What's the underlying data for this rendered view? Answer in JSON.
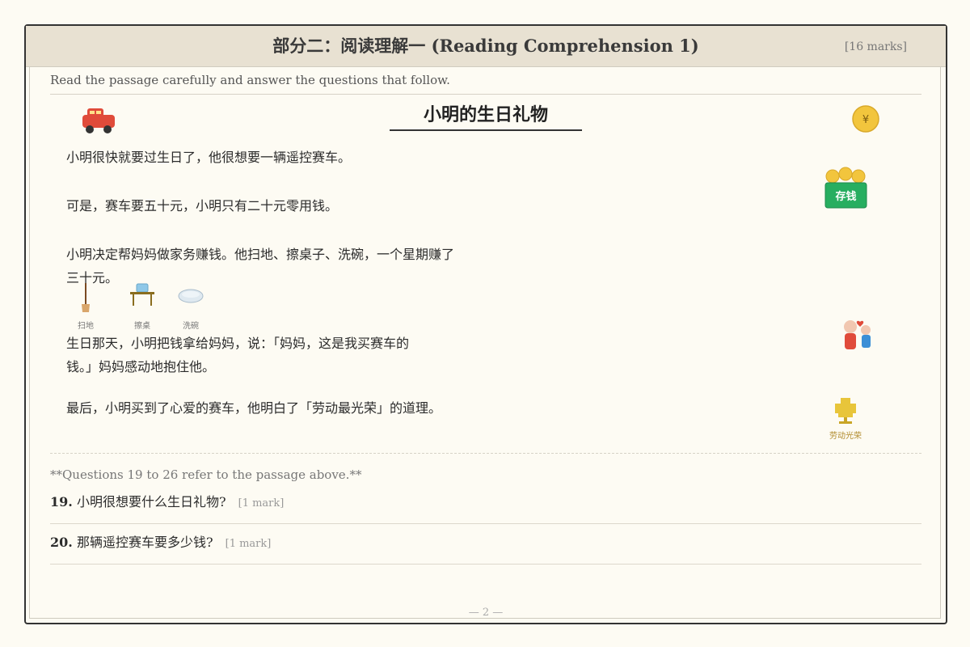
{
  "header": {
    "title": "部分二：阅读理解一 (Reading Comprehension 1)",
    "marks": "[16 marks]"
  },
  "instruction": "Read the passage carefully and answer the questions that follow.",
  "story": {
    "title": "小明的生日礼物",
    "paragraphs": [
      "小明很快就要过生日了，他很想要一辆遥控赛车。",
      "可是，赛车要五十元，小明只有二十元零用钱。",
      "小明决定帮妈妈做家务赚钱。他扫地、擦桌子、洗碗，一个星期赚了",
      "三十元。",
      "生日那天，小明把钱拿给妈妈，说：「妈妈，这是我买赛车的",
      "钱。」妈妈感动地抱住他。",
      "最后，小明买到了心爱的赛车，他明白了「劳动最光荣」的道理。"
    ],
    "chores": [
      "扫地",
      "擦桌",
      "洗碗"
    ],
    "icons": {
      "car": "toy-car-icon",
      "coin": "coin-icon",
      "coin_symbol": "¥",
      "savings": "savings-icon",
      "savings_label": "存钱",
      "hug": "hug-icon",
      "trophy": "trophy-icon",
      "trophy_label": "劳动光荣"
    }
  },
  "questions_note": "**Questions 19 to 26 refer to the passage above.**",
  "questions": [
    {
      "number": "19.",
      "text": "小明很想要什么生日礼物?",
      "marks": "[1 mark]"
    },
    {
      "number": "20.",
      "text": "那辆遥控赛车要多少钱?",
      "marks": "[1 mark]"
    }
  ],
  "page_number": "— 2 —",
  "colors": {
    "header_bg": "#e8e1d2",
    "page_bg": "#fdfbf3",
    "car_red": "#e04b3a",
    "coin_gold": "#f2c53d",
    "savings_green": "#27ae60"
  }
}
